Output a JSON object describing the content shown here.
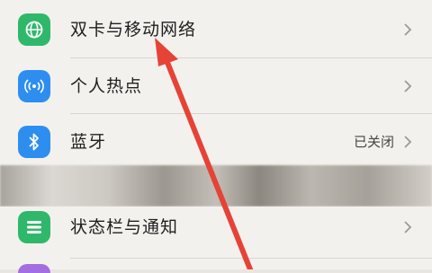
{
  "settings": {
    "rows": [
      {
        "label": "双卡与移动网络",
        "value": "",
        "icon": "globe-icon",
        "icon_color": "#2fb86a"
      },
      {
        "label": "个人热点",
        "value": "",
        "icon": "hotspot-icon",
        "icon_color": "#2d8ef0"
      },
      {
        "label": "蓝牙",
        "value": "已关闭",
        "icon": "bluetooth-icon",
        "icon_color": "#2d8ef0"
      }
    ],
    "rows2": [
      {
        "label": "状态栏与通知",
        "value": "",
        "icon": "status-bar-icon",
        "icon_color": "#2fb86a"
      }
    ]
  },
  "annotation": {
    "arrow_color": "#e64337"
  }
}
